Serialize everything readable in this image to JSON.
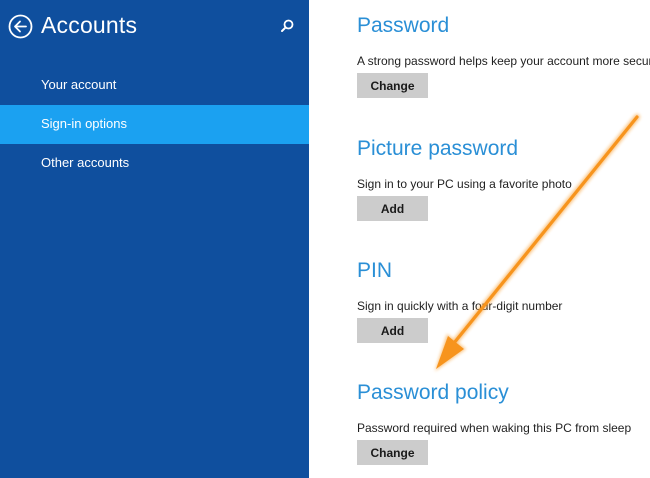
{
  "sidebar": {
    "title": "Accounts",
    "items": [
      {
        "label": "Your account",
        "active": false
      },
      {
        "label": "Sign-in options",
        "active": true
      },
      {
        "label": "Other accounts",
        "active": false
      }
    ]
  },
  "sections": [
    {
      "title": "Password",
      "description": "A strong password helps keep your account more secure",
      "button": "Change"
    },
    {
      "title": "Picture password",
      "description": "Sign in to your PC using a favorite photo",
      "button": "Add"
    },
    {
      "title": "PIN",
      "description": "Sign in quickly with a four-digit number",
      "button": "Add"
    },
    {
      "title": "Password policy",
      "description": "Password required when waking this PC from sleep",
      "button": "Change"
    }
  ],
  "colors": {
    "sidebar_bg": "#0f4f9e",
    "active_item": "#1ba1f1",
    "heading_blue": "#2a8fd6",
    "button_gray": "#cccccc",
    "arrow_orange": "#f7941d"
  }
}
